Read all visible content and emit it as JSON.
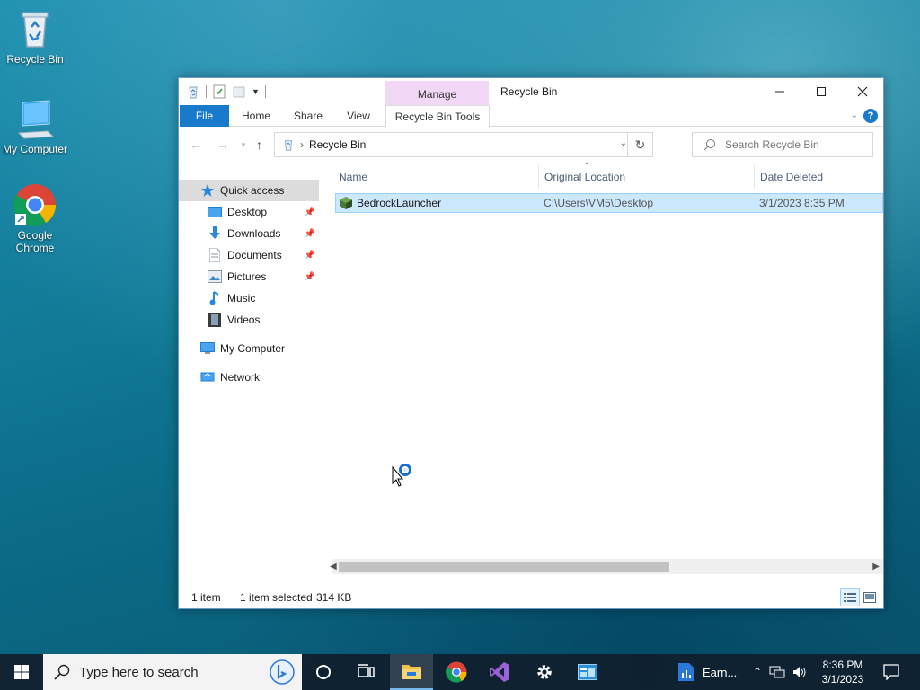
{
  "desktop": {
    "icons": [
      {
        "label": "Recycle Bin",
        "icon": "recycle-bin-icon"
      },
      {
        "label": "My Computer",
        "icon": "computer-icon"
      },
      {
        "label": "Google Chrome",
        "icon": "chrome-icon"
      }
    ]
  },
  "window": {
    "title": "Recycle Bin",
    "manage_tab": "Manage",
    "ribbon_tabs": {
      "file": "File",
      "home": "Home",
      "share": "Share",
      "view": "View",
      "tools": "Recycle Bin Tools"
    },
    "address": {
      "breadcrumb": "Recycle Bin",
      "search_placeholder": "Search Recycle Bin"
    },
    "nav_pane": {
      "quick_access": "Quick access",
      "items": [
        {
          "label": "Desktop",
          "pinned": true
        },
        {
          "label": "Downloads",
          "pinned": true
        },
        {
          "label": "Documents",
          "pinned": true
        },
        {
          "label": "Pictures",
          "pinned": true
        },
        {
          "label": "Music",
          "pinned": false
        },
        {
          "label": "Videos",
          "pinned": false
        }
      ],
      "my_computer": "My Computer",
      "network": "Network"
    },
    "columns": {
      "name": "Name",
      "original_location": "Original Location",
      "date_deleted": "Date Deleted"
    },
    "files": [
      {
        "name": "BedrockLauncher",
        "original_location": "C:\\Users\\VM5\\Desktop",
        "date_deleted": "3/1/2023 8:35 PM",
        "selected": true
      }
    ],
    "status": {
      "count": "1 item",
      "selection": "1 item selected",
      "size": "314 KB"
    }
  },
  "taskbar": {
    "search_placeholder": "Type here to search",
    "earnings_label": "Earn...",
    "time": "8:36 PM",
    "date": "3/1/2023"
  },
  "colors": {
    "accent": "#1979ca",
    "selection": "#cce8ff",
    "manage_tab": "#f2d8f6"
  }
}
